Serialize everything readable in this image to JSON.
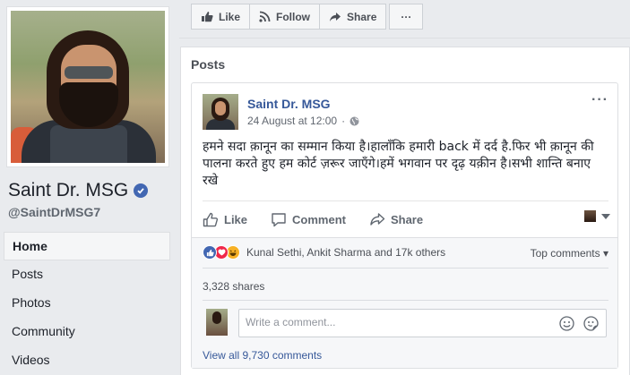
{
  "page": {
    "name": "Saint Dr. MSG",
    "handle": "@SaintDrMSG7"
  },
  "nav": {
    "items": [
      {
        "label": "Home",
        "active": true
      },
      {
        "label": "Posts"
      },
      {
        "label": "Photos"
      },
      {
        "label": "Community"
      },
      {
        "label": "Videos"
      }
    ]
  },
  "action_bar": {
    "like": "Like",
    "follow": "Follow",
    "share": "Share",
    "more": "···"
  },
  "posts_section": {
    "title": "Posts"
  },
  "post": {
    "author": "Saint Dr. MSG",
    "timestamp": "24 August at 12:00",
    "menu": "···",
    "text": "हमने सदा क़ानून का सम्मान किया है।हालाँकि हमारी back में दर्द है.फिर भी क़ानून की पालना करते हुए हम कोर्ट ज़रूर जाएँगे।हमें भगवान पर दृढ़ यक़ीन है।सभी शान्ति बनाए रखे",
    "actions": {
      "like": "Like",
      "comment": "Comment",
      "share": "Share"
    },
    "reactions_text": "Kunal Sethi, Ankit Sharma and 17k others",
    "top_comments": "Top comments ▾",
    "shares": "3,328 shares",
    "comment_placeholder": "Write a comment...",
    "view_all": "View all 9,730 comments"
  },
  "colors": {
    "link": "#365899",
    "brand": "#4267b2",
    "love": "#f0284a",
    "haha": "#f7b125",
    "background": "#e9ebee"
  }
}
